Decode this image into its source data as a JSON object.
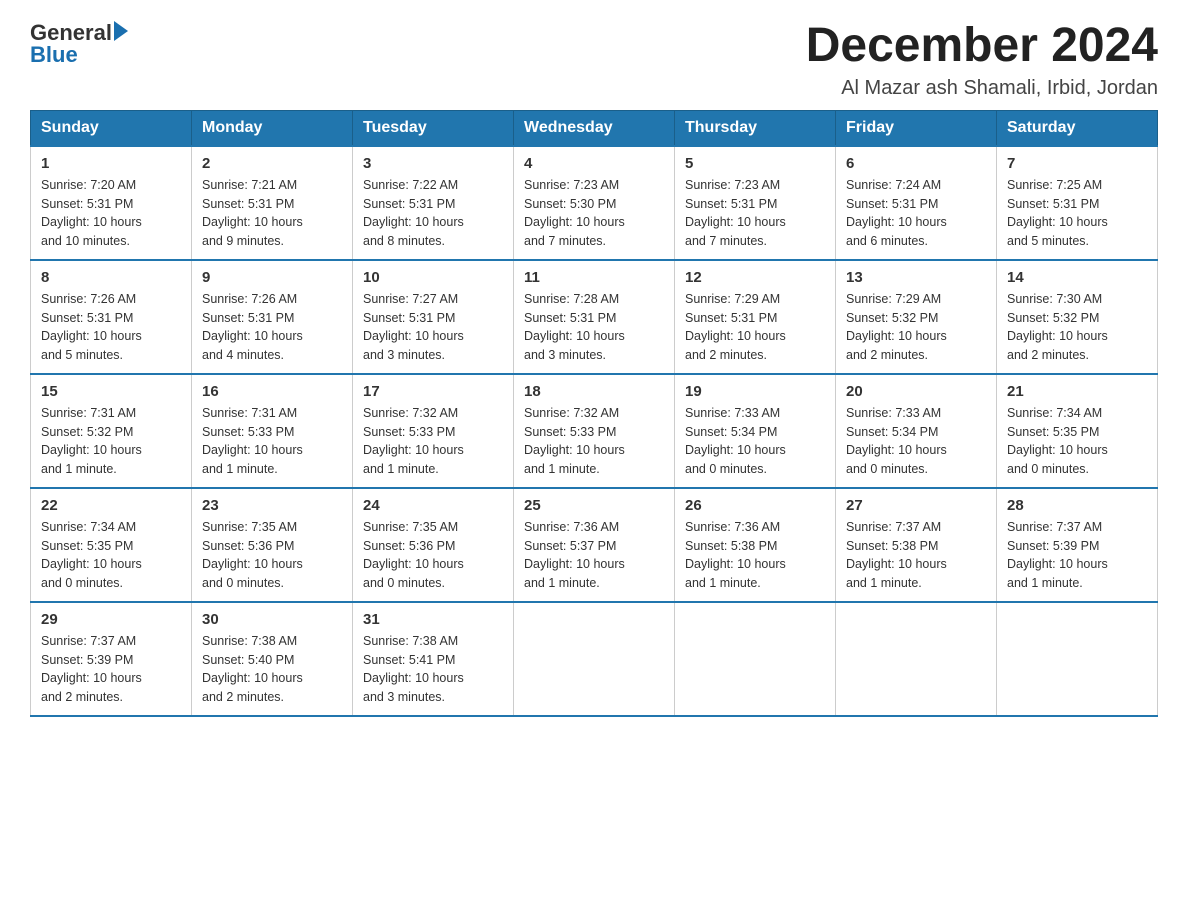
{
  "header": {
    "logo_general": "General",
    "logo_blue": "Blue",
    "month_title": "December 2024",
    "location": "Al Mazar ash Shamali, Irbid, Jordan"
  },
  "days_of_week": [
    "Sunday",
    "Monday",
    "Tuesday",
    "Wednesday",
    "Thursday",
    "Friday",
    "Saturday"
  ],
  "weeks": [
    [
      {
        "day": "1",
        "sunrise": "7:20 AM",
        "sunset": "5:31 PM",
        "daylight": "10 hours and 10 minutes."
      },
      {
        "day": "2",
        "sunrise": "7:21 AM",
        "sunset": "5:31 PM",
        "daylight": "10 hours and 9 minutes."
      },
      {
        "day": "3",
        "sunrise": "7:22 AM",
        "sunset": "5:31 PM",
        "daylight": "10 hours and 8 minutes."
      },
      {
        "day": "4",
        "sunrise": "7:23 AM",
        "sunset": "5:30 PM",
        "daylight": "10 hours and 7 minutes."
      },
      {
        "day": "5",
        "sunrise": "7:23 AM",
        "sunset": "5:31 PM",
        "daylight": "10 hours and 7 minutes."
      },
      {
        "day": "6",
        "sunrise": "7:24 AM",
        "sunset": "5:31 PM",
        "daylight": "10 hours and 6 minutes."
      },
      {
        "day": "7",
        "sunrise": "7:25 AM",
        "sunset": "5:31 PM",
        "daylight": "10 hours and 5 minutes."
      }
    ],
    [
      {
        "day": "8",
        "sunrise": "7:26 AM",
        "sunset": "5:31 PM",
        "daylight": "10 hours and 5 minutes."
      },
      {
        "day": "9",
        "sunrise": "7:26 AM",
        "sunset": "5:31 PM",
        "daylight": "10 hours and 4 minutes."
      },
      {
        "day": "10",
        "sunrise": "7:27 AM",
        "sunset": "5:31 PM",
        "daylight": "10 hours and 3 minutes."
      },
      {
        "day": "11",
        "sunrise": "7:28 AM",
        "sunset": "5:31 PM",
        "daylight": "10 hours and 3 minutes."
      },
      {
        "day": "12",
        "sunrise": "7:29 AM",
        "sunset": "5:31 PM",
        "daylight": "10 hours and 2 minutes."
      },
      {
        "day": "13",
        "sunrise": "7:29 AM",
        "sunset": "5:32 PM",
        "daylight": "10 hours and 2 minutes."
      },
      {
        "day": "14",
        "sunrise": "7:30 AM",
        "sunset": "5:32 PM",
        "daylight": "10 hours and 2 minutes."
      }
    ],
    [
      {
        "day": "15",
        "sunrise": "7:31 AM",
        "sunset": "5:32 PM",
        "daylight": "10 hours and 1 minute."
      },
      {
        "day": "16",
        "sunrise": "7:31 AM",
        "sunset": "5:33 PM",
        "daylight": "10 hours and 1 minute."
      },
      {
        "day": "17",
        "sunrise": "7:32 AM",
        "sunset": "5:33 PM",
        "daylight": "10 hours and 1 minute."
      },
      {
        "day": "18",
        "sunrise": "7:32 AM",
        "sunset": "5:33 PM",
        "daylight": "10 hours and 1 minute."
      },
      {
        "day": "19",
        "sunrise": "7:33 AM",
        "sunset": "5:34 PM",
        "daylight": "10 hours and 0 minutes."
      },
      {
        "day": "20",
        "sunrise": "7:33 AM",
        "sunset": "5:34 PM",
        "daylight": "10 hours and 0 minutes."
      },
      {
        "day": "21",
        "sunrise": "7:34 AM",
        "sunset": "5:35 PM",
        "daylight": "10 hours and 0 minutes."
      }
    ],
    [
      {
        "day": "22",
        "sunrise": "7:34 AM",
        "sunset": "5:35 PM",
        "daylight": "10 hours and 0 minutes."
      },
      {
        "day": "23",
        "sunrise": "7:35 AM",
        "sunset": "5:36 PM",
        "daylight": "10 hours and 0 minutes."
      },
      {
        "day": "24",
        "sunrise": "7:35 AM",
        "sunset": "5:36 PM",
        "daylight": "10 hours and 0 minutes."
      },
      {
        "day": "25",
        "sunrise": "7:36 AM",
        "sunset": "5:37 PM",
        "daylight": "10 hours and 1 minute."
      },
      {
        "day": "26",
        "sunrise": "7:36 AM",
        "sunset": "5:38 PM",
        "daylight": "10 hours and 1 minute."
      },
      {
        "day": "27",
        "sunrise": "7:37 AM",
        "sunset": "5:38 PM",
        "daylight": "10 hours and 1 minute."
      },
      {
        "day": "28",
        "sunrise": "7:37 AM",
        "sunset": "5:39 PM",
        "daylight": "10 hours and 1 minute."
      }
    ],
    [
      {
        "day": "29",
        "sunrise": "7:37 AM",
        "sunset": "5:39 PM",
        "daylight": "10 hours and 2 minutes."
      },
      {
        "day": "30",
        "sunrise": "7:38 AM",
        "sunset": "5:40 PM",
        "daylight": "10 hours and 2 minutes."
      },
      {
        "day": "31",
        "sunrise": "7:38 AM",
        "sunset": "5:41 PM",
        "daylight": "10 hours and 3 minutes."
      },
      null,
      null,
      null,
      null
    ]
  ],
  "labels": {
    "sunrise": "Sunrise:",
    "sunset": "Sunset:",
    "daylight": "Daylight:"
  }
}
